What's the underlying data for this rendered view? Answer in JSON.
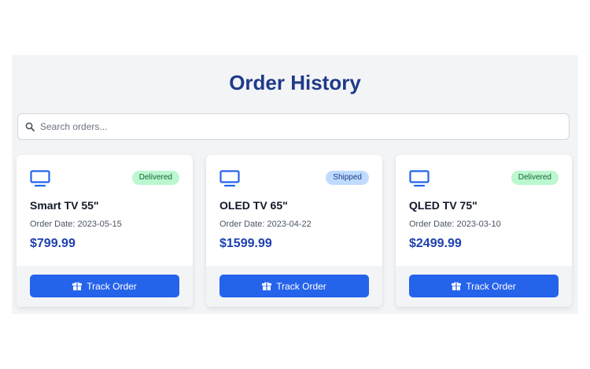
{
  "page": {
    "title": "Order History",
    "search_placeholder": "Search orders..."
  },
  "orders": [
    {
      "name": "Smart TV 55\"",
      "date": "Order Date: 2023-05-15",
      "price": "$799.99",
      "status": "Delivered",
      "button": "Track Order"
    },
    {
      "name": "OLED TV 65\"",
      "date": "Order Date: 2023-04-22",
      "price": "$1599.99",
      "status": "Shipped",
      "button": "Track Order"
    },
    {
      "name": "QLED TV 75\"",
      "date": "Order Date: 2023-03-10",
      "price": "$2499.99",
      "status": "Delivered",
      "button": "Track Order"
    }
  ],
  "icons": {
    "search": "search-icon",
    "product": "tv-icon",
    "button": "gift-box-icon"
  },
  "colors": {
    "title": "#1e3a8a",
    "accent": "#2563eb",
    "price": "#1e40af",
    "delivered_bg": "#bbf7d0",
    "shipped_bg": "#bfdbfe"
  }
}
